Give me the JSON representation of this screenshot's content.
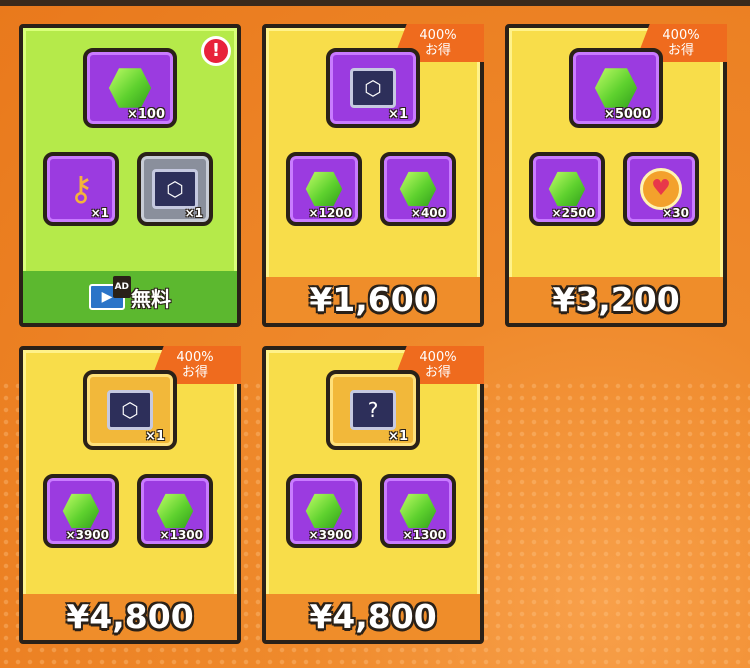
{
  "shop": {
    "cards": [
      {
        "id": "free",
        "alert": "!",
        "items": [
          {
            "icon": "gem-icon",
            "qty": "×100"
          },
          {
            "icon": "key-icon",
            "qty": "×1"
          },
          {
            "icon": "chest-icon",
            "qty": "×1"
          }
        ],
        "footer_label": "無料",
        "ad_label": "AD"
      },
      {
        "id": "pack-1600",
        "tag_line1": "400%",
        "tag_line2": "お得",
        "items": [
          {
            "icon": "chest-icon",
            "qty": "×1"
          },
          {
            "icon": "gem-icon",
            "qty": "×1200"
          },
          {
            "icon": "gem-icon",
            "qty": "×400"
          }
        ],
        "price": "¥1,600"
      },
      {
        "id": "pack-3200",
        "tag_line1": "400%",
        "tag_line2": "お得",
        "items": [
          {
            "icon": "gem-icon",
            "qty": "×5000"
          },
          {
            "icon": "gem-icon",
            "qty": "×2500"
          },
          {
            "icon": "heart-coin-icon",
            "qty": "×30"
          }
        ],
        "price": "¥3,200"
      },
      {
        "id": "pack-4800-a",
        "tag_line1": "400%",
        "tag_line2": "お得",
        "items": [
          {
            "icon": "chest-icon",
            "qty": "×1"
          },
          {
            "icon": "gem-icon",
            "qty": "×3900"
          },
          {
            "icon": "gem-icon",
            "qty": "×1300"
          }
        ],
        "price": "¥4,800"
      },
      {
        "id": "pack-4800-b",
        "tag_line1": "400%",
        "tag_line2": "お得",
        "items": [
          {
            "icon": "mystery-chest-icon",
            "qty": "×1"
          },
          {
            "icon": "gem-icon",
            "qty": "×3900"
          },
          {
            "icon": "gem-icon",
            "qty": "×1300"
          }
        ],
        "price": "¥4,800"
      }
    ]
  }
}
